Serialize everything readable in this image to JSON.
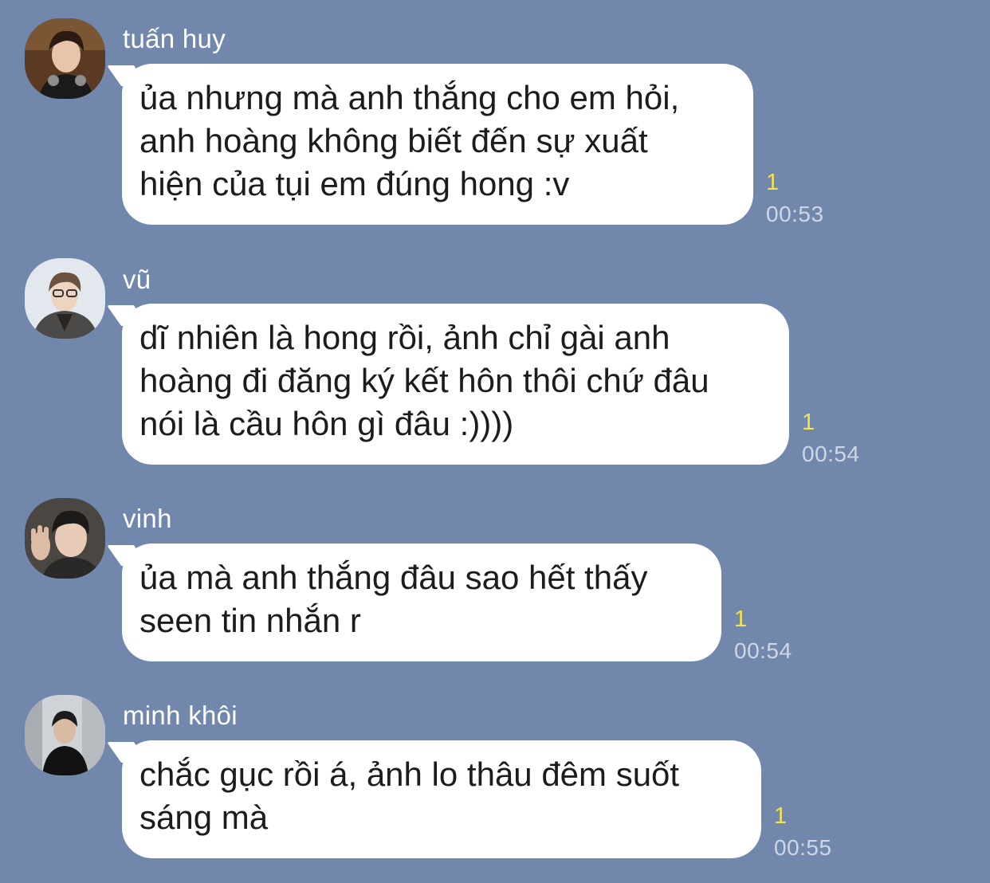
{
  "messages": [
    {
      "sender": "tuấn huy",
      "avatar_icon": "profile-photo-icon",
      "text": "ủa nhưng mà anh thắng cho em hỏi,\nanh hoàng không biết đến sự xuất\nhiện của tụi em đúng hong :v",
      "read_count": "1",
      "time": "00:53"
    },
    {
      "sender": "vũ",
      "avatar_icon": "profile-photo-icon",
      "text": "dĩ nhiên là hong rồi, ảnh chỉ gài anh\nhoàng đi đăng ký kết hôn thôi chứ đâu\nnói là cầu hôn gì đâu :))))",
      "read_count": "1",
      "time": "00:54"
    },
    {
      "sender": "vinh",
      "avatar_icon": "profile-photo-icon",
      "text": "ủa mà anh thắng đâu sao hết thấy\nseen tin nhắn r",
      "read_count": "1",
      "time": "00:54"
    },
    {
      "sender": "minh khôi",
      "avatar_icon": "profile-photo-icon",
      "text": "chắc gục rồi á, ảnh lo thâu đêm suốt\nsáng mà",
      "read_count": "1",
      "time": "00:55"
    }
  ],
  "colors": {
    "background": "#7187ab",
    "bubble": "#ffffff",
    "read_count": "#f5e34a",
    "time": "#cfd7e6"
  }
}
